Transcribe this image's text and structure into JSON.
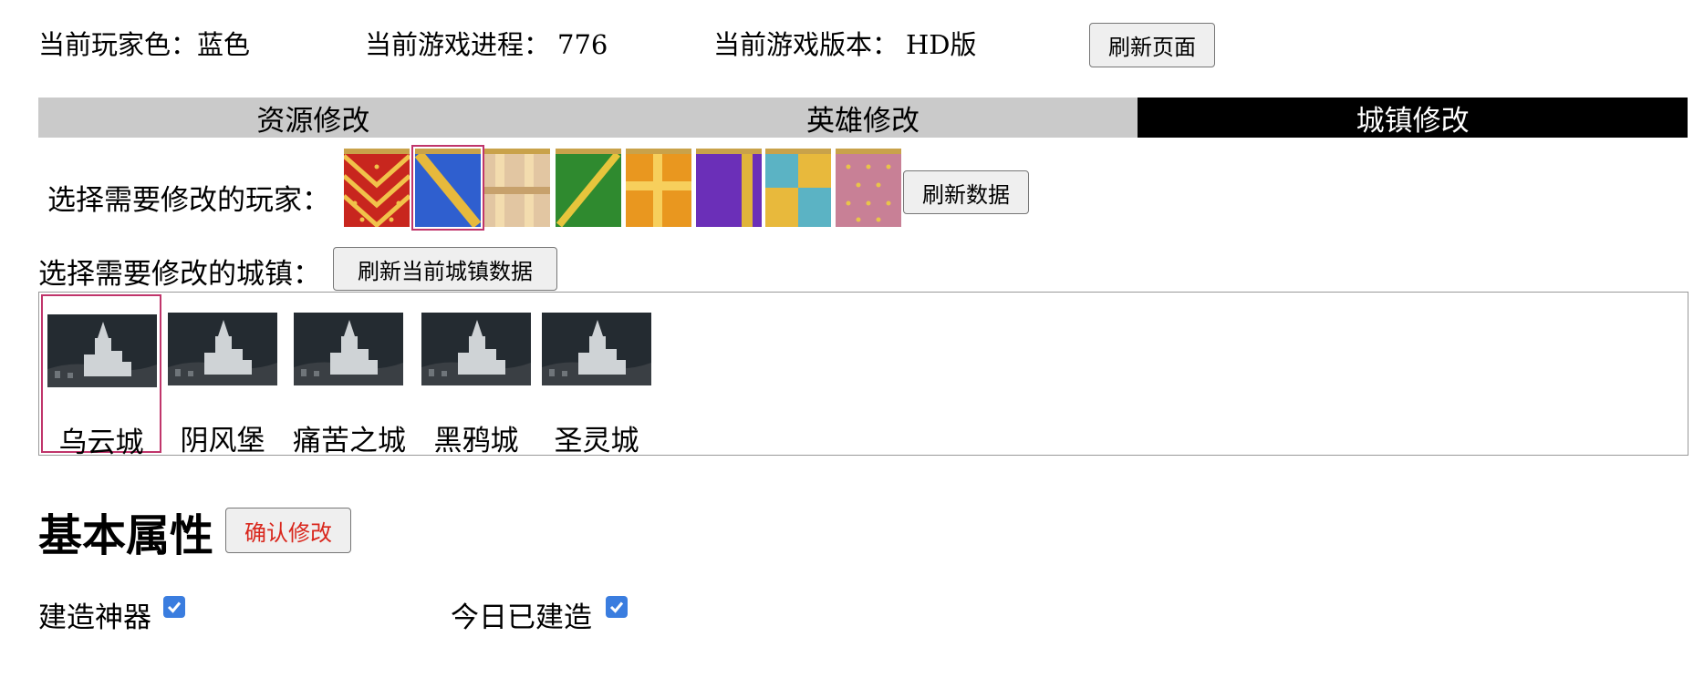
{
  "status": {
    "player_color_label": "当前玩家色：",
    "player_color_value": "蓝色",
    "progress_label": "当前游戏进程：",
    "progress_value": "776",
    "version_label": "当前游戏版本：",
    "version_value": "HD版",
    "refresh_page": "刷新页面"
  },
  "tabs": [
    {
      "label": "资源修改",
      "active": false
    },
    {
      "label": "英雄修改",
      "active": false
    },
    {
      "label": "城镇修改",
      "active": true
    }
  ],
  "player_select": {
    "label": "选择需要修改的玩家：",
    "refresh": "刷新数据",
    "flags": [
      {
        "color": "red",
        "selected": false
      },
      {
        "color": "blue",
        "selected": true
      },
      {
        "color": "tan",
        "selected": false
      },
      {
        "color": "green",
        "selected": false
      },
      {
        "color": "orange",
        "selected": false
      },
      {
        "color": "purple",
        "selected": false
      },
      {
        "color": "teal",
        "selected": false
      },
      {
        "color": "pink",
        "selected": false
      }
    ]
  },
  "town_select": {
    "label": "选择需要修改的城镇：",
    "refresh": "刷新当前城镇数据",
    "towns": [
      {
        "name": "乌云城",
        "selected": true
      },
      {
        "name": "阴风堡",
        "selected": false
      },
      {
        "name": "痛苦之城",
        "selected": false
      },
      {
        "name": "黑鸦城",
        "selected": false
      },
      {
        "name": "圣灵城",
        "selected": false
      }
    ]
  },
  "basic": {
    "title": "基本属性",
    "confirm": "确认修改",
    "options": [
      {
        "label": "建造神器",
        "checked": true
      },
      {
        "label": "今日已建造",
        "checked": true
      }
    ]
  },
  "colors": {
    "selection": "#c0356b",
    "active_tab_bg": "#000000",
    "tab_bg": "#cacaca",
    "confirm_text": "#d9261c",
    "checkbox": "#3a7ddf"
  }
}
